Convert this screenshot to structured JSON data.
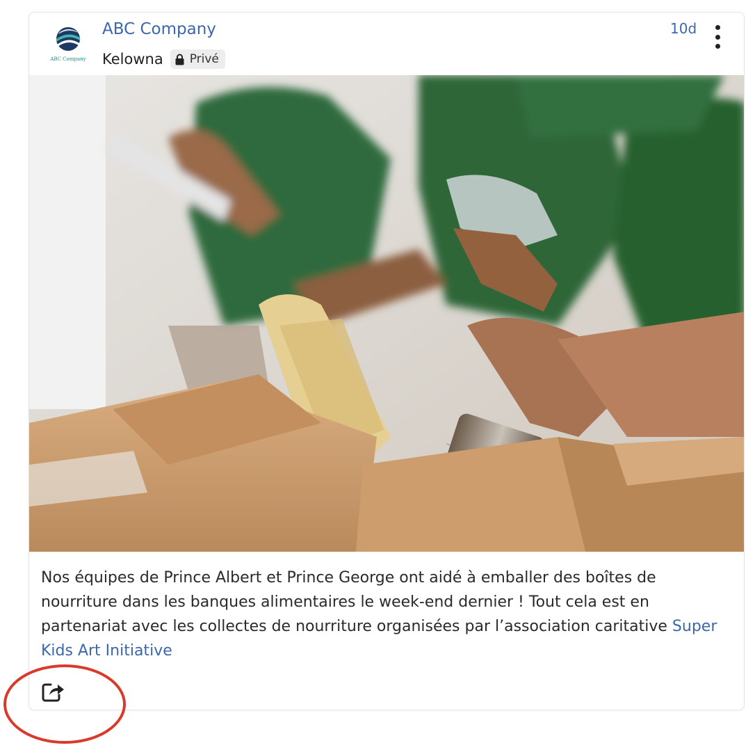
{
  "post": {
    "company_name": "ABC Company",
    "logo_text": "ABC Company",
    "location": "Kelowna",
    "privacy_label": "Privé",
    "time_ago": "10d",
    "body_text": "Nos équipes de Prince Albert et Prince George ont aidé à emballer des boîtes de nourriture dans les banques alimentaires le week-end dernier ! Tout cela est en partenariat avec les collectes de nourriture organisées par l’association caritative ",
    "link_text": "Super Kids Art Initiative"
  },
  "icons": {
    "privacy": "lock-icon",
    "menu": "more-vertical-icon",
    "share": "share-icon"
  },
  "colors": {
    "link": "#3d67ad",
    "annotation": "#d93a2b",
    "shirts": "#2f6a3c",
    "boxes": "#c99a6c"
  }
}
